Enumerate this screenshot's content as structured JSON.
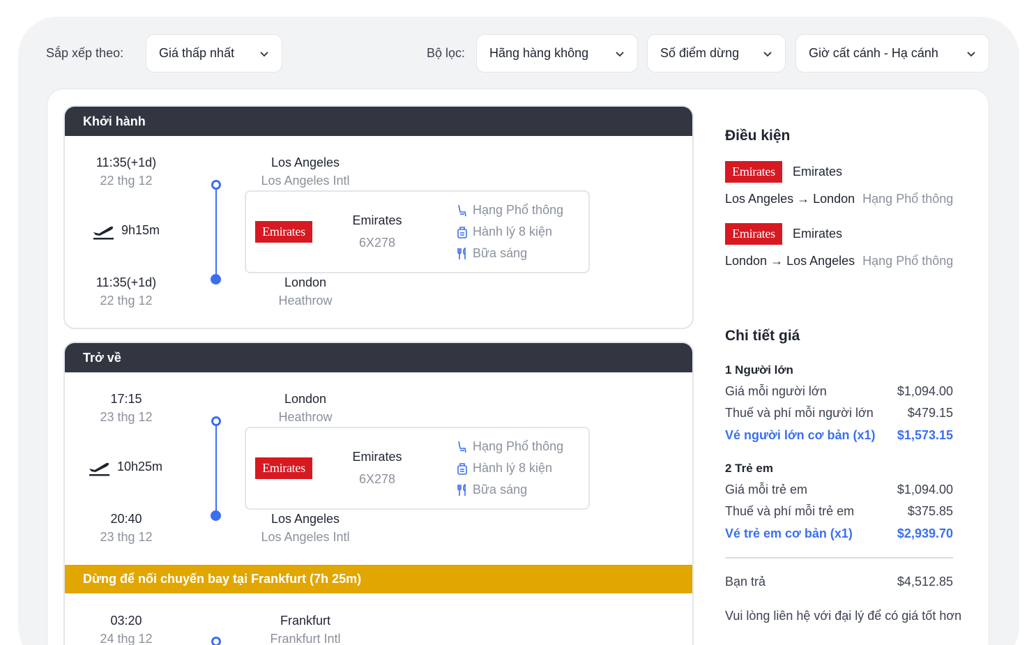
{
  "toolbar": {
    "sort_label": "Sắp xếp theo:",
    "sort_value": "Giá thấp nhất",
    "filter_label": "Bộ lọc:",
    "filters": [
      "Hãng hàng không",
      "Số điểm dừng",
      "Giờ cất cánh - Hạ cánh"
    ]
  },
  "departure": {
    "header": "Khởi hành",
    "dep_time": "11:35(+1d)",
    "dep_date": "22 thg 12",
    "duration": "9h15m",
    "arr_time": "11:35(+1d)",
    "arr_date": "22 thg 12",
    "origin_city": "Los Angeles",
    "origin_airport": "Los Angeles Intl",
    "dest_city": "London",
    "dest_airport": "Heathrow",
    "logo_text": "Emirates",
    "airline": "Emirates",
    "flight_no": "6X278",
    "cabin": "Hạng Phổ thông",
    "baggage": "Hành lý 8 kiện",
    "meal": "Bữa sáng"
  },
  "return": {
    "header": "Trở về",
    "dep_time": "17:15",
    "dep_date": "23 thg 12",
    "duration": "10h25m",
    "arr_time": "20:40",
    "arr_date": "23 thg 12",
    "origin_city": "London",
    "origin_airport": "Heathrow",
    "dest_city": "Los Angeles",
    "dest_airport": "Los Angeles Intl",
    "logo_text": "Emirates",
    "airline": "Emirates",
    "flight_no": "6X278",
    "cabin": "Hạng Phổ thông",
    "baggage": "Hành lý 8 kiện",
    "meal": "Bữa sáng",
    "stopover": "Dừng để nối chuyến bay tại Frankfurt (7h 25m)",
    "next_time": "03:20",
    "next_date": "24 thg 12",
    "next_city": "Frankfurt",
    "next_airport": "Frankfurt Intl"
  },
  "conditions": {
    "title": "Điều kiện",
    "items": [
      {
        "logo": "Emirates",
        "airline": "Emirates",
        "from": "Los Angeles",
        "arrow": "→",
        "to": "London",
        "cabin": "Hạng Phổ thông"
      },
      {
        "logo": "Emirates",
        "airline": "Emirates",
        "from": "London",
        "arrow": "→",
        "to": "Los Angeles",
        "cabin": "Hạng Phổ thông"
      }
    ]
  },
  "price": {
    "title": "Chi tiết giá",
    "adult_group": "1 Người lớn",
    "adult_rows": [
      {
        "label": "Giá mỗi người lớn",
        "value": "$1,094.00"
      },
      {
        "label": "Thuế và phí mỗi người lớn",
        "value": "$479.15"
      },
      {
        "label": "Vé người lớn cơ bản (x1)",
        "value": "$1,573.15"
      }
    ],
    "child_group": "2 Trẻ em",
    "child_rows": [
      {
        "label": "Giá mỗi trẻ em",
        "value": "$1,094.00"
      },
      {
        "label": "Thuế và phí mỗi trẻ em",
        "value": "$375.85"
      },
      {
        "label": "Vé trẻ em cơ bản (x1)",
        "value": "$2,939.70"
      }
    ],
    "total_label": "Bạn trả",
    "total_value": "$4,512.85",
    "note": "Vui lòng liên hệ với đại lý để có giá tốt hơn"
  },
  "colors": {
    "accent": "#3b6ff2",
    "header": "#323640",
    "stopover": "#e2a600",
    "emirates_red": "#d71921"
  },
  "icons": [
    "chevron-down-icon",
    "plane-takeoff-icon",
    "seat-icon",
    "luggage-icon",
    "meal-icon"
  ]
}
